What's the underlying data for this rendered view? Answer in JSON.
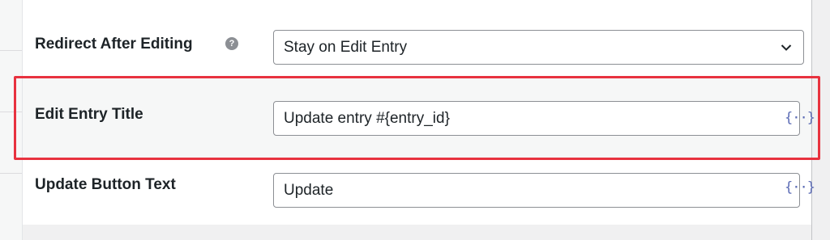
{
  "settings": {
    "redirect": {
      "label": "Redirect After Editing",
      "help_icon": "?",
      "value": "Stay on Edit Entry"
    },
    "edit_title": {
      "label": "Edit Entry Title",
      "value": "Update entry #{entry_id}",
      "merge_tag": "{··}"
    },
    "button_text": {
      "label": "Update Button Text",
      "value": "Update",
      "merge_tag": "{··}"
    }
  },
  "colors": {
    "highlight_border": "#e8323f",
    "merge_tag_icon": "#5b6bb5"
  }
}
